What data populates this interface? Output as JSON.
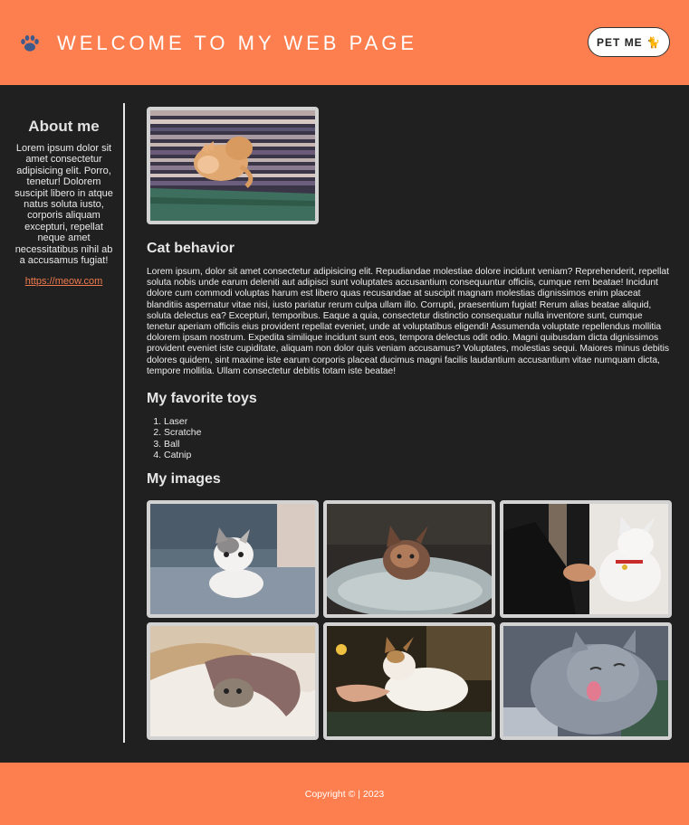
{
  "header": {
    "title": "WELCOME TO MY WEB PAGE",
    "pet_button_label": "PET ME 🐈",
    "logo_icon": "paw-icon",
    "background": "#fd7f4f"
  },
  "sidebar": {
    "title": "About me",
    "text": "Lorem ipsum dolor sit amet consectetur adipisicing elit. Porro, tenetur! Dolorem suscipit libero in atque natus soluta iusto, corporis aliquam excepturi, repellat neque amet necessitatibus nihil ab a accusamus fugiat!",
    "link": "https://meow.com"
  },
  "main": {
    "behavior_title": "Cat behavior",
    "behavior_text": "Lorem ipsum, dolor sit amet consectetur adipisicing elit. Repudiandae molestiae dolore incidunt veniam? Reprehenderit, repellat soluta nobis unde earum deleniti aut adipisci sunt voluptates accusantium consequuntur officiis, cumque rem beatae! Incidunt dolore cum commodi voluptas harum est libero quas recusandae at suscipit magnam molestias dignissimos enim placeat blanditiis aspernatur vitae nisi, iusto pariatur rerum culpa ullam illo. Corrupti, praesentium fugiat! Rerum alias beatae aliquid, soluta delectus ea? Excepturi, temporibus. Eaque a quia, consectetur distinctio consequatur nulla inventore sunt, cumque tenetur aperiam officiis eius provident repellat eveniet, unde at voluptatibus eligendi! Assumenda voluptate repellendus mollitia dolorem ipsam nostrum. Expedita similique incidunt sunt eos, tempora delectus odit odio. Magni quibusdam dicta dignissimos provident eveniet iste cupiditate, aliquam non dolor quis veniam accusamus? Voluptates, molestias sequi. Maiores minus debitis dolores quidem, sint maxime iste earum corporis placeat ducimus magni facilis laudantium accusantium vitae numquam dicta, tempore mollitia. Ullam consectetur debitis totam iste beatae!",
    "toys_title": "My favorite toys",
    "toys": [
      "Laser",
      "Scratche",
      "Ball",
      "Catnip"
    ],
    "images_title": "My images"
  },
  "footer": {
    "copyright": "Copyright © | 2023"
  }
}
